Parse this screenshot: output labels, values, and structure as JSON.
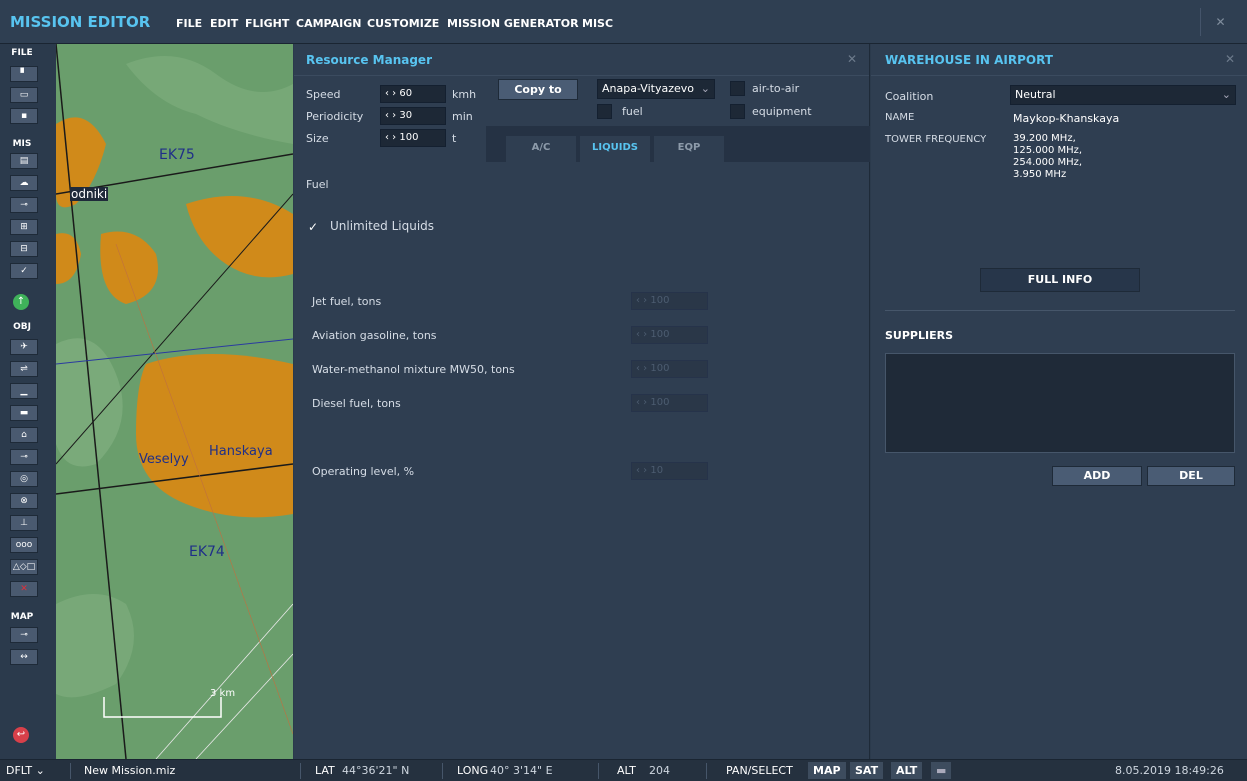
{
  "app": {
    "title": "MISSION EDITOR"
  },
  "menu": [
    "FILE",
    "EDIT",
    "FLIGHT",
    "CAMPAIGN",
    "CUSTOMIZE",
    "MISSION GENERATOR",
    "MISC"
  ],
  "toolbar": {
    "sections": [
      "FILE",
      "MIS",
      "OBJ",
      "MAP"
    ]
  },
  "map": {
    "labels": {
      "ek75": "EK75",
      "ek74": "EK74",
      "veselyy": "Veselyy",
      "hanskaya": "Hanskaya",
      "odniki": "odniki"
    },
    "scale": "3 km"
  },
  "resource_manager": {
    "title": "Resource Manager",
    "speed_label": "Speed",
    "speed_value": "60",
    "speed_unit": "kmh",
    "periodicity_label": "Periodicity",
    "periodicity_value": "30",
    "periodicity_unit": "min",
    "size_label": "Size",
    "size_value": "100",
    "size_unit": "t",
    "copy_to": "Copy to",
    "airport_select": "Anapa-Vityazevo",
    "checks": {
      "air_to_air": "air-to-air",
      "fuel": "fuel",
      "equipment": "equipment"
    },
    "tabs": [
      "A/C",
      "LIQUIDS",
      "EQP"
    ],
    "active_tab": "LIQUIDS",
    "section": "Fuel",
    "unlimited": "Unlimited Liquids",
    "fields": [
      {
        "label": "Jet fuel, tons",
        "value": "100"
      },
      {
        "label": "Aviation gasoline, tons",
        "value": "100"
      },
      {
        "label": "Water-methanol mixture MW50, tons",
        "value": "100"
      },
      {
        "label": "Diesel fuel, tons",
        "value": "100"
      }
    ],
    "operating_label": "Operating level, %",
    "operating_value": "10"
  },
  "warehouse": {
    "title": "WAREHOUSE IN AIRPORT",
    "coalition_label": "Coalition",
    "coalition_value": "Neutral",
    "name_label": "NAME",
    "name_value": "Maykop-Khanskaya",
    "tower_label": "TOWER FREQUENCY",
    "tower_values": [
      "39.200 MHz,",
      "125.000 MHz,",
      "254.000 MHz,",
      "3.950 MHz"
    ],
    "full_info": "FULL INFO",
    "suppliers": "SUPPLIERS",
    "add": "ADD",
    "del": "DEL"
  },
  "status": {
    "profile": "DFLT",
    "file": "New Mission.miz",
    "lat_label": "LAT",
    "lat": "44°36'21\" N",
    "long_label": "LONG",
    "long": "40° 3'14\" E",
    "alt_label": "ALT",
    "alt": "204",
    "mode": "PAN/SELECT",
    "buttons": [
      "MAP",
      "SAT",
      "ALT"
    ],
    "datetime": "8.05.2019 18:49:26"
  },
  "colors": {
    "accent": "#58c4f0",
    "panel": "#2f3e51",
    "terrain": "#6a9e6c",
    "urban": "#d08a1a"
  }
}
